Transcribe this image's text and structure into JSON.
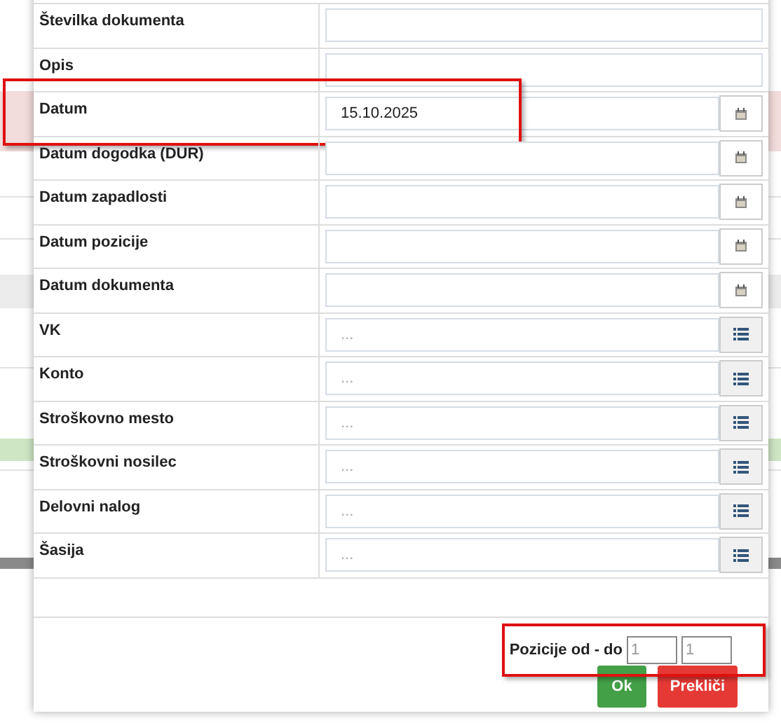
{
  "fields": [
    {
      "label": "Številka dokumenta",
      "kind": "text",
      "highlighted": false
    },
    {
      "label": "Opis",
      "kind": "text",
      "highlighted": false
    },
    {
      "label": "Datum",
      "kind": "date",
      "value": "15.10.2025",
      "highlighted": true
    },
    {
      "label": "Datum dogodka (DUR)",
      "kind": "date",
      "highlighted": false
    },
    {
      "label": "Datum zapadlosti",
      "kind": "date",
      "highlighted": false
    },
    {
      "label": "Datum pozicije",
      "kind": "date",
      "highlighted": false
    },
    {
      "label": "Datum dokumenta",
      "kind": "date",
      "highlighted": false
    },
    {
      "label": "VK",
      "kind": "lookup",
      "placeholder": "...",
      "highlighted": false
    },
    {
      "label": "Konto",
      "kind": "lookup",
      "placeholder": "...",
      "highlighted": false
    },
    {
      "label": "Stroškovno mesto",
      "kind": "lookup",
      "placeholder": "...",
      "highlighted": false
    },
    {
      "label": "Stroškovni nosilec",
      "kind": "lookup",
      "placeholder": "...",
      "highlighted": false
    },
    {
      "label": "Delovni nalog",
      "kind": "lookup",
      "placeholder": "...",
      "highlighted": false
    },
    {
      "label": "Šasija",
      "kind": "lookup",
      "placeholder": "...",
      "highlighted": false
    }
  ],
  "range": {
    "label": "Pozicije od - do",
    "from": "1",
    "to": "1",
    "highlighted": true
  },
  "buttons": [
    {
      "label": "Ok",
      "kind": "confirm"
    },
    {
      "label": "Prekliči",
      "kind": "cancel"
    }
  ]
}
